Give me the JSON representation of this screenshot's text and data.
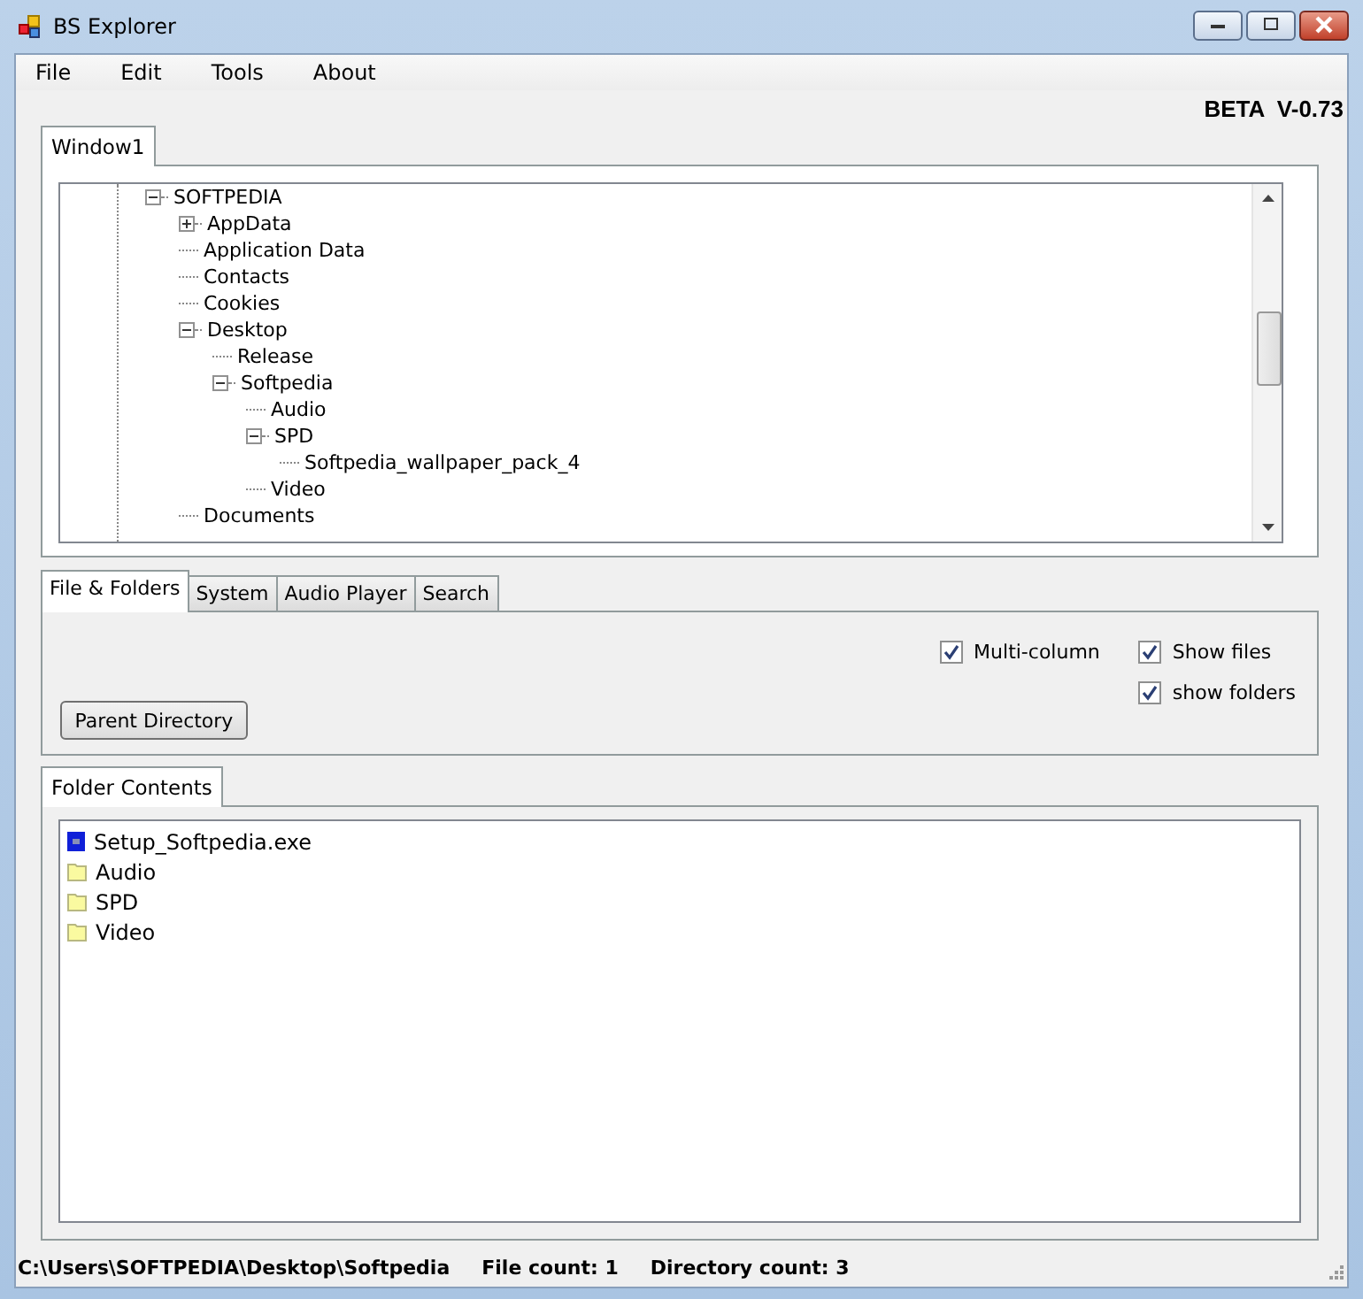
{
  "window": {
    "title": "BS Explorer"
  },
  "menu": [
    "File",
    "Edit",
    "Tools",
    "About"
  ],
  "version": "BETA  V-0.73",
  "top_tabs": [
    {
      "label": "Window1",
      "selected": true
    }
  ],
  "tree": {
    "items": [
      {
        "label": "SOFTPEDIA",
        "expanded": true,
        "children": [
          {
            "label": "AppData",
            "expanded": false
          },
          {
            "label": "Application Data"
          },
          {
            "label": "Contacts"
          },
          {
            "label": "Cookies"
          },
          {
            "label": "Desktop",
            "expanded": true,
            "children": [
              {
                "label": "Release"
              },
              {
                "label": "Softpedia",
                "expanded": true,
                "children": [
                  {
                    "label": "Audio"
                  },
                  {
                    "label": "SPD",
                    "expanded": true,
                    "children": [
                      {
                        "label": "Softpedia_wallpaper_pack_4"
                      }
                    ]
                  },
                  {
                    "label": "Video"
                  }
                ]
              }
            ]
          },
          {
            "label": "Documents"
          }
        ]
      }
    ]
  },
  "tool_tabs": [
    {
      "label": "File & Folders",
      "selected": true
    },
    {
      "label": "System",
      "selected": false
    },
    {
      "label": "Audio Player",
      "selected": false
    },
    {
      "label": "Search",
      "selected": false
    }
  ],
  "parent_button": "Parent Directory",
  "option_columns": [
    [
      {
        "label": "Multi-column",
        "checked": true
      }
    ],
    [
      {
        "label": "Show files",
        "checked": true
      },
      {
        "label": "show folders",
        "checked": true
      }
    ]
  ],
  "contents_tab": {
    "label": "Folder Contents",
    "selected": true
  },
  "contents": [
    {
      "kind": "file",
      "name": "Setup_Softpedia.exe"
    },
    {
      "kind": "folder",
      "name": "Audio"
    },
    {
      "kind": "folder",
      "name": "SPD"
    },
    {
      "kind": "folder",
      "name": "Video"
    }
  ],
  "status_bar": {
    "path": "C:\\Users\\SOFTPEDIA\\Desktop\\Softpedia",
    "file_count": "File count: 1",
    "directory_count": "Directory count: 3"
  }
}
